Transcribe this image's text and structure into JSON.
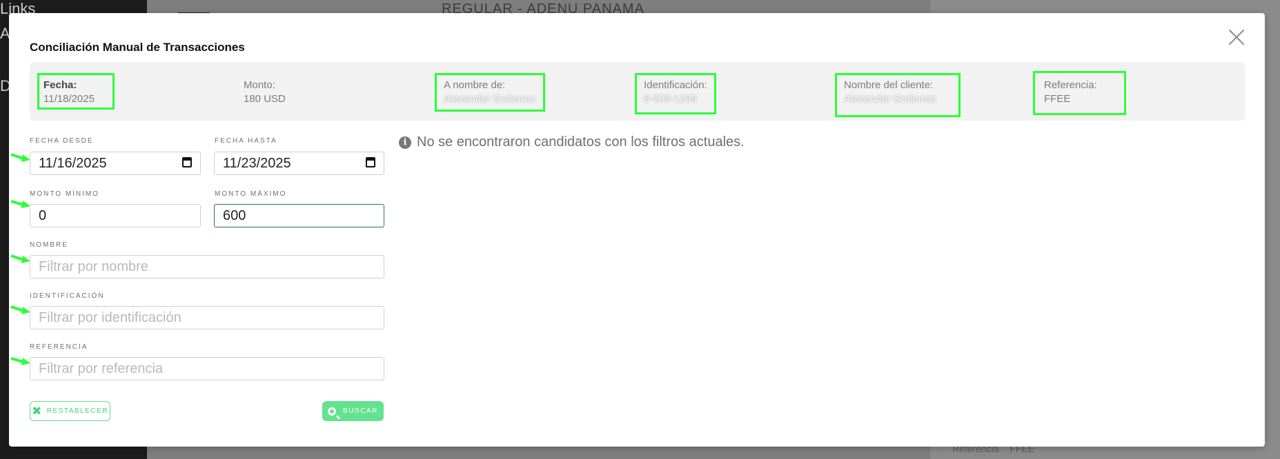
{
  "background": {
    "sidebar_text_1": "Links",
    "sidebar_text_2": "A",
    "sidebar_text_3": "D",
    "header_text": "REGULAR - ADENU PANAMA",
    "footer_label": "Referencia",
    "footer_value": "FFEE"
  },
  "modal": {
    "title": "Conciliación Manual de Transacciones",
    "summary": {
      "fecha_label": "Fecha:",
      "fecha_value": "11/18/2025",
      "monto_label": "Monto:",
      "monto_value": "180 USD",
      "anombre_label": "A nombre de:",
      "anombre_value": "Alexander Gutierrez",
      "ident_label": "Identificación:",
      "ident_value": "8-909-1298",
      "cliente_label": "Nombre del cliente:",
      "cliente_value": "Alexander Gutierrez",
      "ref_label": "Referencia:",
      "ref_value": "FFEE"
    },
    "filters": {
      "fecha_desde_label": "FECHA DESDE",
      "fecha_desde_value": "11/16/2025",
      "fecha_hasta_label": "FECHA HASTA",
      "fecha_hasta_value": "11/23/2025",
      "monto_min_label": "MONTO MÍNIMO",
      "monto_min_value": "0",
      "monto_max_label": "MONTO MÁXIMO",
      "monto_max_value": "600",
      "nombre_label": "NOMBRE",
      "nombre_placeholder": "Filtrar por nombre",
      "ident_label": "IDENTIFICACIÓN",
      "ident_placeholder": "Filtrar por identificación",
      "ref_label": "REFERENCIA",
      "ref_placeholder": "Filtrar por referencia"
    },
    "buttons": {
      "reset_label": "RESTABLECER",
      "search_label": "BUSCAR"
    },
    "empty_message": "No se encontraron candidatos con los filtros actuales."
  },
  "colors": {
    "accent_green": "#63e28f",
    "highlight_green": "#2bff38",
    "focus_border": "#2a6a7e"
  }
}
